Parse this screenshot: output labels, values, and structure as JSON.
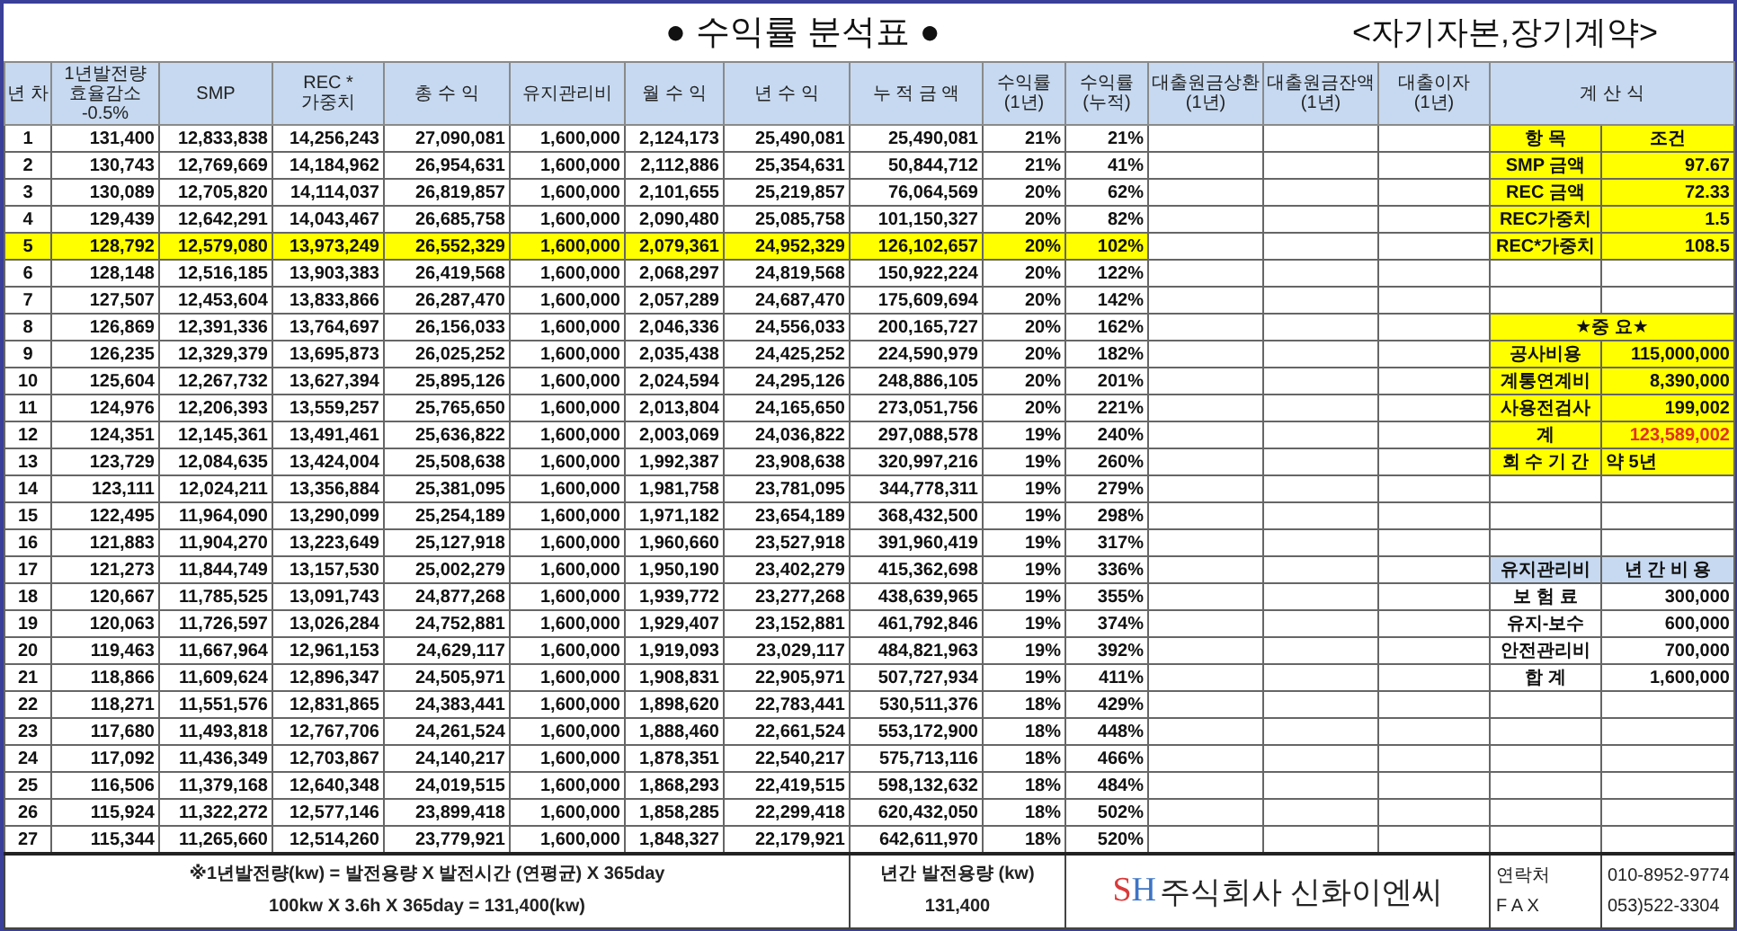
{
  "title": "● 수익률 분석표 ●",
  "subtitle": "<자기자본,장기계약>",
  "columns": [
    "년 차",
    "1년발전량 효율감소 -0.5%",
    "SMP",
    "REC * 가중치",
    "총 수 익",
    "유지관리비",
    "월 수 익",
    "년 수 익",
    "누 적 금 액",
    "수익률(1년)",
    "수익률(누적)",
    "대출원금상환 (1년)",
    "대출원금잔액 (1년)",
    "대출이자 (1년)",
    "계 산 식"
  ],
  "rows": [
    {
      "highlighted": false,
      "cells": [
        "1",
        "131,400",
        "12,833,838",
        "14,256,243",
        "27,090,081",
        "1,600,000",
        "2,124,173",
        "25,490,081",
        "25,490,081",
        "21%",
        "21%"
      ]
    },
    {
      "highlighted": false,
      "cells": [
        "2",
        "130,743",
        "12,769,669",
        "14,184,962",
        "26,954,631",
        "1,600,000",
        "2,112,886",
        "25,354,631",
        "50,844,712",
        "21%",
        "41%"
      ]
    },
    {
      "highlighted": false,
      "cells": [
        "3",
        "130,089",
        "12,705,820",
        "14,114,037",
        "26,819,857",
        "1,600,000",
        "2,101,655",
        "25,219,857",
        "76,064,569",
        "20%",
        "62%"
      ]
    },
    {
      "highlighted": false,
      "cells": [
        "4",
        "129,439",
        "12,642,291",
        "14,043,467",
        "26,685,758",
        "1,600,000",
        "2,090,480",
        "25,085,758",
        "101,150,327",
        "20%",
        "82%"
      ]
    },
    {
      "highlighted": true,
      "cells": [
        "5",
        "128,792",
        "12,579,080",
        "13,973,249",
        "26,552,329",
        "1,600,000",
        "2,079,361",
        "24,952,329",
        "126,102,657",
        "20%",
        "102%"
      ]
    },
    {
      "highlighted": false,
      "cells": [
        "6",
        "128,148",
        "12,516,185",
        "13,903,383",
        "26,419,568",
        "1,600,000",
        "2,068,297",
        "24,819,568",
        "150,922,224",
        "20%",
        "122%"
      ]
    },
    {
      "highlighted": false,
      "cells": [
        "7",
        "127,507",
        "12,453,604",
        "13,833,866",
        "26,287,470",
        "1,600,000",
        "2,057,289",
        "24,687,470",
        "175,609,694",
        "20%",
        "142%"
      ]
    },
    {
      "highlighted": false,
      "cells": [
        "8",
        "126,869",
        "12,391,336",
        "13,764,697",
        "26,156,033",
        "1,600,000",
        "2,046,336",
        "24,556,033",
        "200,165,727",
        "20%",
        "162%"
      ]
    },
    {
      "highlighted": false,
      "cells": [
        "9",
        "126,235",
        "12,329,379",
        "13,695,873",
        "26,025,252",
        "1,600,000",
        "2,035,438",
        "24,425,252",
        "224,590,979",
        "20%",
        "182%"
      ]
    },
    {
      "highlighted": false,
      "cells": [
        "10",
        "125,604",
        "12,267,732",
        "13,627,394",
        "25,895,126",
        "1,600,000",
        "2,024,594",
        "24,295,126",
        "248,886,105",
        "20%",
        "201%"
      ]
    },
    {
      "highlighted": false,
      "cells": [
        "11",
        "124,976",
        "12,206,393",
        "13,559,257",
        "25,765,650",
        "1,600,000",
        "2,013,804",
        "24,165,650",
        "273,051,756",
        "20%",
        "221%"
      ]
    },
    {
      "highlighted": false,
      "cells": [
        "12",
        "124,351",
        "12,145,361",
        "13,491,461",
        "25,636,822",
        "1,600,000",
        "2,003,069",
        "24,036,822",
        "297,088,578",
        "19%",
        "240%"
      ]
    },
    {
      "highlighted": false,
      "cells": [
        "13",
        "123,729",
        "12,084,635",
        "13,424,004",
        "25,508,638",
        "1,600,000",
        "1,992,387",
        "23,908,638",
        "320,997,216",
        "19%",
        "260%"
      ]
    },
    {
      "highlighted": false,
      "cells": [
        "14",
        "123,111",
        "12,024,211",
        "13,356,884",
        "25,381,095",
        "1,600,000",
        "1,981,758",
        "23,781,095",
        "344,778,311",
        "19%",
        "279%"
      ]
    },
    {
      "highlighted": false,
      "cells": [
        "15",
        "122,495",
        "11,964,090",
        "13,290,099",
        "25,254,189",
        "1,600,000",
        "1,971,182",
        "23,654,189",
        "368,432,500",
        "19%",
        "298%"
      ]
    },
    {
      "highlighted": false,
      "cells": [
        "16",
        "121,883",
        "11,904,270",
        "13,223,649",
        "25,127,918",
        "1,600,000",
        "1,960,660",
        "23,527,918",
        "391,960,419",
        "19%",
        "317%"
      ]
    },
    {
      "highlighted": false,
      "cells": [
        "17",
        "121,273",
        "11,844,749",
        "13,157,530",
        "25,002,279",
        "1,600,000",
        "1,950,190",
        "23,402,279",
        "415,362,698",
        "19%",
        "336%"
      ]
    },
    {
      "highlighted": false,
      "cells": [
        "18",
        "120,667",
        "11,785,525",
        "13,091,743",
        "24,877,268",
        "1,600,000",
        "1,939,772",
        "23,277,268",
        "438,639,965",
        "19%",
        "355%"
      ]
    },
    {
      "highlighted": false,
      "cells": [
        "19",
        "120,063",
        "11,726,597",
        "13,026,284",
        "24,752,881",
        "1,600,000",
        "1,929,407",
        "23,152,881",
        "461,792,846",
        "19%",
        "374%"
      ]
    },
    {
      "highlighted": false,
      "cells": [
        "20",
        "119,463",
        "11,667,964",
        "12,961,153",
        "24,629,117",
        "1,600,000",
        "1,919,093",
        "23,029,117",
        "484,821,963",
        "19%",
        "392%"
      ]
    },
    {
      "highlighted": false,
      "cells": [
        "21",
        "118,866",
        "11,609,624",
        "12,896,347",
        "24,505,971",
        "1,600,000",
        "1,908,831",
        "22,905,971",
        "507,727,934",
        "19%",
        "411%"
      ]
    },
    {
      "highlighted": false,
      "cells": [
        "22",
        "118,271",
        "11,551,576",
        "12,831,865",
        "24,383,441",
        "1,600,000",
        "1,898,620",
        "22,783,441",
        "530,511,376",
        "18%",
        "429%"
      ]
    },
    {
      "highlighted": false,
      "cells": [
        "23",
        "117,680",
        "11,493,818",
        "12,767,706",
        "24,261,524",
        "1,600,000",
        "1,888,460",
        "22,661,524",
        "553,172,900",
        "18%",
        "448%"
      ]
    },
    {
      "highlighted": false,
      "cells": [
        "24",
        "117,092",
        "11,436,349",
        "12,703,867",
        "24,140,217",
        "1,600,000",
        "1,878,351",
        "22,540,217",
        "575,713,116",
        "18%",
        "466%"
      ]
    },
    {
      "highlighted": false,
      "cells": [
        "25",
        "116,506",
        "11,379,168",
        "12,640,348",
        "24,019,515",
        "1,600,000",
        "1,868,293",
        "22,419,515",
        "598,132,632",
        "18%",
        "484%"
      ]
    },
    {
      "highlighted": false,
      "cells": [
        "26",
        "115,924",
        "11,322,272",
        "12,577,146",
        "23,899,418",
        "1,600,000",
        "1,858,285",
        "22,299,418",
        "620,432,050",
        "18%",
        "502%"
      ]
    },
    {
      "highlighted": false,
      "cells": [
        "27",
        "115,344",
        "11,265,660",
        "12,514,260",
        "23,779,921",
        "1,600,000",
        "1,848,327",
        "22,179,921",
        "642,611,970",
        "18%",
        "520%"
      ]
    }
  ],
  "side_panel": [
    {
      "kind": "heading",
      "label": "항 목",
      "value": "조건"
    },
    {
      "kind": "yellow",
      "label": "SMP 금액",
      "value": "97.67"
    },
    {
      "kind": "yellow",
      "label": "REC 금액",
      "value": "72.33"
    },
    {
      "kind": "yellow",
      "label": "REC가중치",
      "value": "1.5"
    },
    {
      "kind": "yellow",
      "label": "REC*가중치",
      "value": "108.5"
    },
    {
      "kind": "blank"
    },
    {
      "kind": "blank"
    },
    {
      "kind": "banner",
      "label": "★중 요★"
    },
    {
      "kind": "yellow",
      "label": "공사비용",
      "value": "115,000,000"
    },
    {
      "kind": "yellow",
      "label": "계통연계비",
      "value": "8,390,000"
    },
    {
      "kind": "yellow",
      "label": "사용전검사",
      "value": "199,002"
    },
    {
      "kind": "total",
      "label": "계",
      "value": "123,589,002"
    },
    {
      "kind": "period",
      "label": "회 수 기 간",
      "value": "약 5년"
    },
    {
      "kind": "blank"
    },
    {
      "kind": "blank"
    },
    {
      "kind": "blank"
    },
    {
      "kind": "section",
      "label": "유지관리비",
      "value": "년 간 비 용"
    },
    {
      "kind": "plain",
      "label": "보 험 료",
      "value": "300,000"
    },
    {
      "kind": "plain",
      "label": "유지-보수",
      "value": "600,000"
    },
    {
      "kind": "plain",
      "label": "안전관리비",
      "value": "700,000"
    },
    {
      "kind": "plain",
      "label": "합 계",
      "value": "1,600,000"
    },
    {
      "kind": "blank"
    },
    {
      "kind": "blank"
    },
    {
      "kind": "blank"
    },
    {
      "kind": "blank"
    },
    {
      "kind": "blank"
    },
    {
      "kind": "blank"
    }
  ],
  "footer": {
    "formula_lines": [
      "※1년발전량(kw) = 발전용량 X 발전시간 (연평균) X 365day",
      "100kw X 3.6h X 365day = 131,400(kw)"
    ],
    "capacity_label": "년간 발전용량 (kw)",
    "capacity_value": "131,400",
    "logo_letters": [
      {
        "text": "S",
        "color": "#d93a3a"
      },
      {
        "text": "H",
        "color": "#3d74c4"
      }
    ],
    "company_name": "주식회사 신화이엔씨",
    "contacts": [
      {
        "label": "연락처",
        "value": "010-8952-9774"
      },
      {
        "label": "F A X",
        "value": "053)522-3304"
      }
    ]
  }
}
